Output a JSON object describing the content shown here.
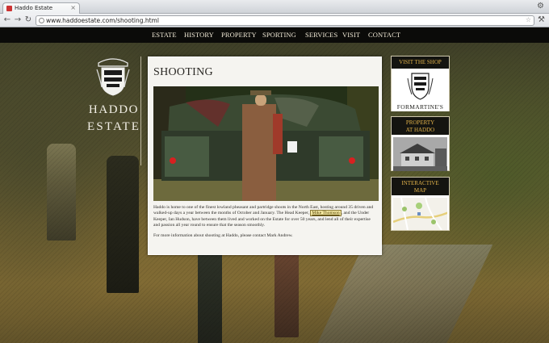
{
  "browser": {
    "tab_title": "Haddo Estate",
    "url": "www.haddoestate.com/shooting.html"
  },
  "nav": {
    "items": [
      "ESTATE",
      "HISTORY",
      "PROPERTY",
      "SPORTING",
      "SERVICES",
      "VISIT",
      "CONTACT"
    ]
  },
  "logo": {
    "line1": "HADDO",
    "line2": "ESTATE"
  },
  "content": {
    "title": "SHOOTING",
    "para1_a": "Haddo is home to one of the finest lowland pheasant and partridge shoots in the North East, hosting around 35 driven and walked-up days a year between the months of October and January. The Head Keeper,",
    "para1_link": "Mike Thomson",
    "para1_b": ", and the Under Keeper, Ian Hudson, have between them lived and worked on the Estate for over 50 years, and lend all of their expertise and passion all year round to ensure that the season smoothly.",
    "para2": "For more information about shooting at Haddo, please contact Mark Andrew."
  },
  "sidebar": {
    "shop": {
      "heading": "VISIT THE SHOP",
      "label": "FORMARTINE'S"
    },
    "property": {
      "heading_line1": "PROPERTY",
      "heading_line2": "AT HADDO"
    },
    "map": {
      "heading_line1": "INTERACTIVE",
      "heading_line2": "MAP"
    }
  },
  "colors": {
    "nav_bg": "#0b0b09",
    "sidebar_heading": "#e2b24a",
    "panel_bg": "#f5f4f0"
  }
}
